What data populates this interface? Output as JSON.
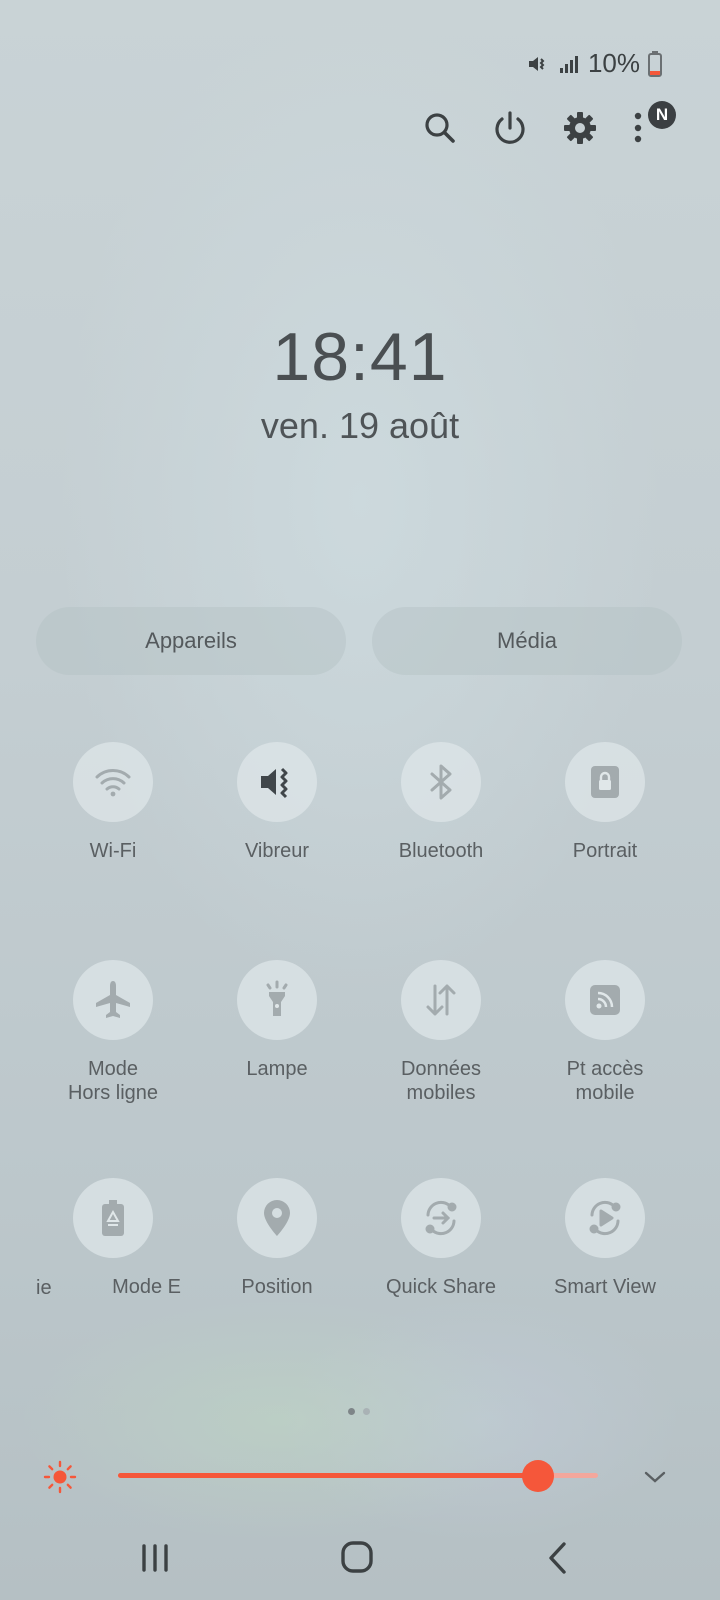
{
  "status_bar": {
    "battery_percent": "10%",
    "battery_level": 0.1,
    "icons": [
      "vibrate-mute-icon",
      "signal-icon",
      "battery-icon"
    ]
  },
  "top_actions": {
    "icons": [
      "search-icon",
      "power-icon",
      "settings-icon",
      "more-icon"
    ],
    "notification_badge": "N"
  },
  "clock": {
    "time": "18:41",
    "date": "ven. 19 août"
  },
  "pills": {
    "devices": "Appareils",
    "media": "Média"
  },
  "tiles": [
    {
      "label": "Wi-Fi",
      "icon": "wifi-icon"
    },
    {
      "label": "Vibreur",
      "icon": "vibrate-icon",
      "active": true
    },
    {
      "label": "Bluetooth",
      "icon": "bluetooth-icon"
    },
    {
      "label": "Portrait",
      "icon": "rotation-lock-icon"
    },
    {
      "label": "Mode\nHors ligne",
      "icon": "airplane-icon"
    },
    {
      "label": "Lampe",
      "icon": "flashlight-icon"
    },
    {
      "label": "Données\nmobiles",
      "icon": "mobile-data-icon"
    },
    {
      "label": "Pt accès\nmobile",
      "icon": "hotspot-icon"
    },
    {
      "label": "Mode E",
      "icon": "power-saving-icon"
    },
    {
      "label": "Position",
      "icon": "location-icon"
    },
    {
      "label": "Quick Share",
      "icon": "quick-share-icon"
    },
    {
      "label": "Smart View",
      "icon": "smart-view-icon"
    }
  ],
  "scrolling_label_fragment": "ie",
  "pager": {
    "pages": 2,
    "current": 1
  },
  "brightness": {
    "level": 0.875,
    "accent": "#f5573a"
  },
  "nav_bar": {
    "icons": [
      "recent-apps-icon",
      "home-icon",
      "back-icon"
    ]
  }
}
